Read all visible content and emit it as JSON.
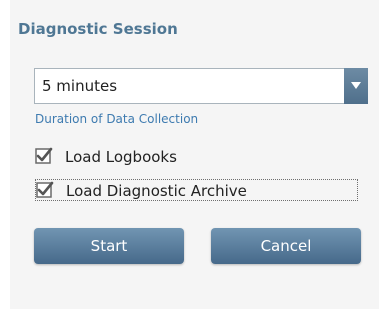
{
  "panel": {
    "title": "Diagnostic Session"
  },
  "duration": {
    "selected": "5 minutes",
    "caption": "Duration of Data Collection"
  },
  "options": [
    {
      "label": "Load Logbooks",
      "checked": true
    },
    {
      "label": "Load Diagnostic Archive",
      "checked": true
    }
  ],
  "buttons": {
    "start": "Start",
    "cancel": "Cancel"
  },
  "colors": {
    "title": "#4f7794",
    "caption": "#3e7bb0",
    "button": "#5b7f9e",
    "panel_bg": "#f5f5f5"
  },
  "icons": {
    "dropdown": "chevron-down-icon",
    "checkbox": "checkmark-icon"
  }
}
